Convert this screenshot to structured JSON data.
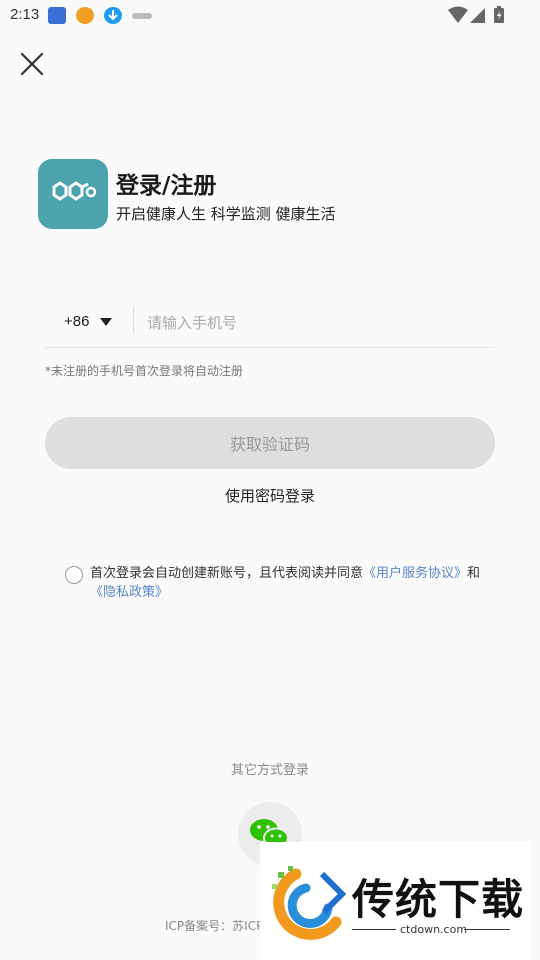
{
  "status_bar": {
    "time": "2:13"
  },
  "header": {
    "title": "登录/注册",
    "subtitle": "开启健康人生 科学监测 健康生活"
  },
  "login": {
    "country_code": "+86",
    "phone_placeholder": "请输入手机号",
    "hint": "*未注册的手机号首次登录将自动注册",
    "get_code_label": "获取验证码",
    "password_login_label": "使用密码登录"
  },
  "agreement": {
    "text_before": "首次登录会自动创建新账号，且代表阅读并同意",
    "user_agreement": "《用户服务协议》",
    "and": "和",
    "privacy_policy": "《隐私政策》",
    "checked": false
  },
  "other_login": {
    "label": "其它方式登录",
    "icon": "wechat-icon"
  },
  "footer": {
    "icp": "ICP备案号：苏ICP"
  },
  "watermark": {
    "text": "传统下载",
    "url": "ctdown.com"
  },
  "colors": {
    "brand": "#4aa3ad",
    "link": "#5a86c8",
    "wechat": "#2dc100",
    "disabled_button": "#dedede"
  }
}
